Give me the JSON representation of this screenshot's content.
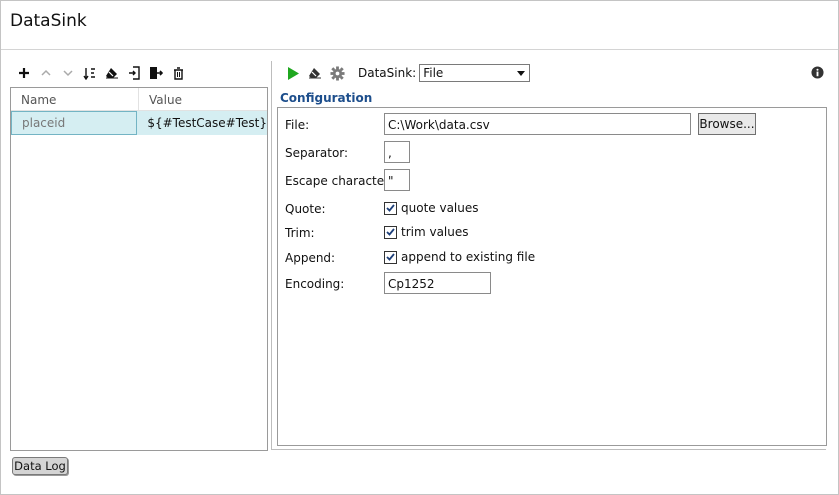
{
  "window": {
    "title": "DataSink"
  },
  "left_toolbar": {
    "icons": [
      "add-icon",
      "move-up-icon",
      "move-down-icon",
      "sort-icon",
      "clear-icon",
      "import-icon",
      "export-icon",
      "delete-icon"
    ]
  },
  "properties_table": {
    "columns": [
      "Name",
      "Value"
    ],
    "rows": [
      {
        "name": "placeid",
        "value": "${#TestCase#Test}"
      }
    ]
  },
  "right_toolbar": {
    "icons": [
      "run-icon",
      "clear-icon",
      "settings-icon",
      "info-icon"
    ],
    "datasink_label": "DataSink:",
    "datasink_selected": "File"
  },
  "configuration": {
    "section_title": "Configuration",
    "file_label": "File:",
    "file_value": "C:\\Work\\data.csv",
    "browse_label": "Browse...",
    "separator_label": "Separator:",
    "separator_value": ",",
    "escape_label": "Escape character:",
    "escape_value": "\"",
    "quote_label": "Quote:",
    "quote_check_label": "quote values",
    "quote_checked": true,
    "trim_label": "Trim:",
    "trim_check_label": "trim values",
    "trim_checked": true,
    "append_label": "Append:",
    "append_check_label": "append to existing file",
    "append_checked": true,
    "encoding_label": "Encoding:",
    "encoding_value": "Cp1252"
  },
  "bottom_tabs": {
    "data_log": "Data Log"
  },
  "colors": {
    "run_green": "#1fa71f",
    "section_blue": "#1d4e8c",
    "row_highlight": "#d5eef2"
  }
}
